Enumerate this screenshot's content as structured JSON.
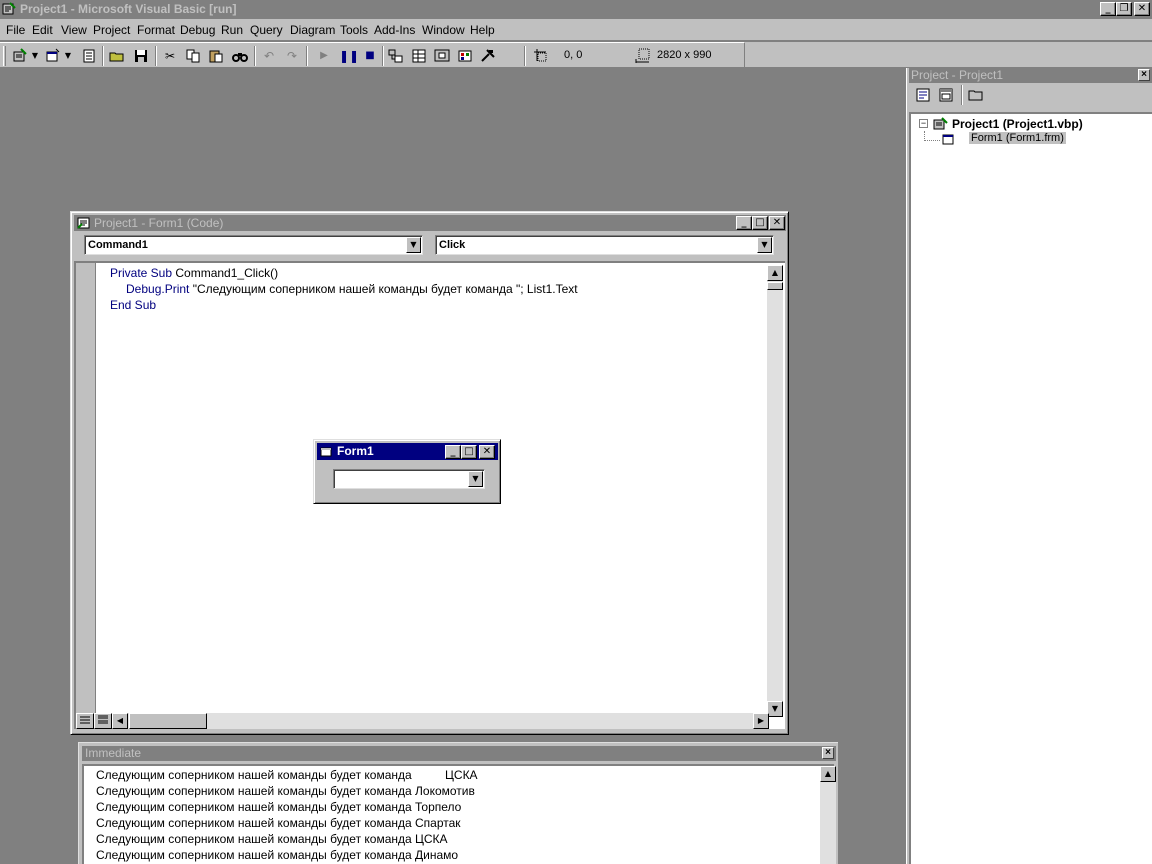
{
  "app": {
    "title": "Project1 - Microsoft Visual Basic [run]"
  },
  "menu": [
    {
      "label": "File",
      "name": "menu-file"
    },
    {
      "label": "Edit",
      "name": "menu-edit"
    },
    {
      "label": "View",
      "name": "menu-view"
    },
    {
      "label": "Project",
      "name": "menu-project"
    },
    {
      "label": "Format",
      "name": "menu-format"
    },
    {
      "label": "Debug",
      "name": "menu-debug"
    },
    {
      "label": "Run",
      "name": "menu-run"
    },
    {
      "label": "Query",
      "name": "menu-query"
    },
    {
      "label": "Diagram",
      "name": "menu-diagram"
    },
    {
      "label": "Tools",
      "name": "menu-tools"
    },
    {
      "label": "Add-Ins",
      "name": "menu-add-ins"
    },
    {
      "label": "Window",
      "name": "menu-window"
    },
    {
      "label": "Help",
      "name": "menu-help"
    }
  ],
  "toolbar": {
    "position": "0, 0",
    "size": "2820 x 990"
  },
  "project_explorer": {
    "title": "Project - Project1",
    "tree": {
      "project": "Project1 (Project1.vbp)",
      "form": "Form1 (Form1.frm)"
    }
  },
  "code_window": {
    "title": "Project1 - Form1 (Code)",
    "object_combo": "Command1",
    "proc_combo": "Click",
    "code": {
      "l1_kw": "Private Sub",
      "l1_rest": " Command1_Click()",
      "l2_kw": "Debug.Print",
      "l2_rest": " \"Следующим соперником нашей команды будет команда \"; List1.Text",
      "l3_kw": "End Sub"
    }
  },
  "form1": {
    "title": "Form1",
    "combo_value": ""
  },
  "immediate": {
    "title": "Immediate",
    "lines": [
      "Следующим соперником нашей команды будет команда          ЦСКА",
      "Следующим соперником нашей команды будет команда Локомотив",
      "Следующим соперником нашей команды будет команда Торпело",
      "Следующим соперником нашей команды будет команда Спартак",
      "Следующим соперником нашей команды будет команда ЦСКА",
      "Следующим соперником нашей команды будет команда Динамо"
    ]
  },
  "colors": {
    "active_caption": "#000080",
    "inactive_caption": "#808080",
    "face": "#c0c0c0",
    "workspace": "#808080",
    "keyword": "#00007f"
  }
}
